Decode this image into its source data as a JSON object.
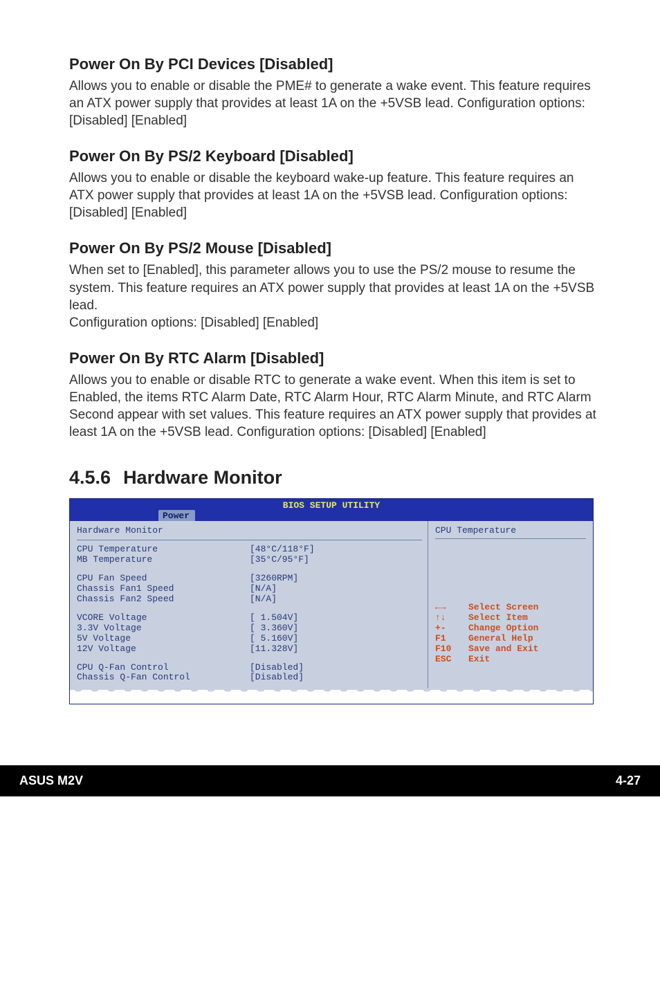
{
  "sections": {
    "s1": {
      "title": "Power On By PCI Devices [Disabled]",
      "body": "Allows you to enable or disable the PME# to generate a wake event. This feature requires an ATX power supply that provides at least 1A on the +5VSB lead. Configuration options: [Disabled] [Enabled]"
    },
    "s2": {
      "title": "Power On By PS/2 Keyboard [Disabled]",
      "body": "Allows you to enable or disable the keyboard wake-up feature. This feature requires an ATX power supply that provides at least 1A on the +5VSB lead. Configuration options: [Disabled] [Enabled]"
    },
    "s3": {
      "title": "Power On By PS/2 Mouse [Disabled]",
      "body": "When set to [Enabled], this parameter allows you to use the PS/2 mouse to resume the system. This feature requires an ATX power supply that provides at least 1A on the +5VSB lead.\nConfiguration options: [Disabled] [Enabled]"
    },
    "s4": {
      "title": "Power On By RTC Alarm [Disabled]",
      "body": "Allows you to enable or disable RTC to generate a wake event. When this item is set to Enabled, the items RTC Alarm Date, RTC Alarm Hour, RTC Alarm Minute, and RTC Alarm Second appear with set values. This feature requires an ATX power supply that provides at least 1A on the +5VSB lead. Configuration options: [Disabled] [Enabled]"
    }
  },
  "subsection": {
    "number": "4.5.6",
    "title": "Hardware Monitor"
  },
  "bios": {
    "title": "BIOS SETUP UTILITY",
    "tab": "Power",
    "left_title": "Hardware Monitor",
    "right_title": "CPU Temperature",
    "rows": {
      "g1r1": {
        "label": "CPU Temperature",
        "value": "[48°C/118°F]"
      },
      "g1r2": {
        "label": "MB Temperature",
        "value": "[35°C/95°F]"
      },
      "g2r1": {
        "label": "CPU Fan Speed",
        "value": "[3260RPM]"
      },
      "g2r2": {
        "label": "Chassis Fan1 Speed",
        "value": "[N/A]"
      },
      "g2r3": {
        "label": "Chassis Fan2 Speed",
        "value": "[N/A]"
      },
      "g3r1": {
        "label": "VCORE Voltage",
        "value": "[ 1.504V]"
      },
      "g3r2": {
        "label": "3.3V Voltage",
        "value": "[ 3.360V]"
      },
      "g3r3": {
        "label": "5V Voltage",
        "value": "[ 5.160V]"
      },
      "g3r4": {
        "label": "12V Voltage",
        "value": "[11.328V]"
      },
      "g4r1": {
        "label": "CPU Q-Fan Control",
        "value": "[Disabled]"
      },
      "g4r2": {
        "label": "Chassis Q-Fan Control",
        "value": "[Disabled]"
      }
    },
    "help": {
      "h1": {
        "key": "←→",
        "label": "Select Screen"
      },
      "h2": {
        "key": "↑↓",
        "label": "Select Item"
      },
      "h3": {
        "key": "+-",
        "label": "Change Option"
      },
      "h4": {
        "key": "F1",
        "label": "General Help"
      },
      "h5": {
        "key": "F10",
        "label": "Save and Exit"
      },
      "h6": {
        "key": "ESC",
        "label": "Exit"
      }
    }
  },
  "footer": {
    "left": "ASUS M2V",
    "right": "4-27"
  }
}
